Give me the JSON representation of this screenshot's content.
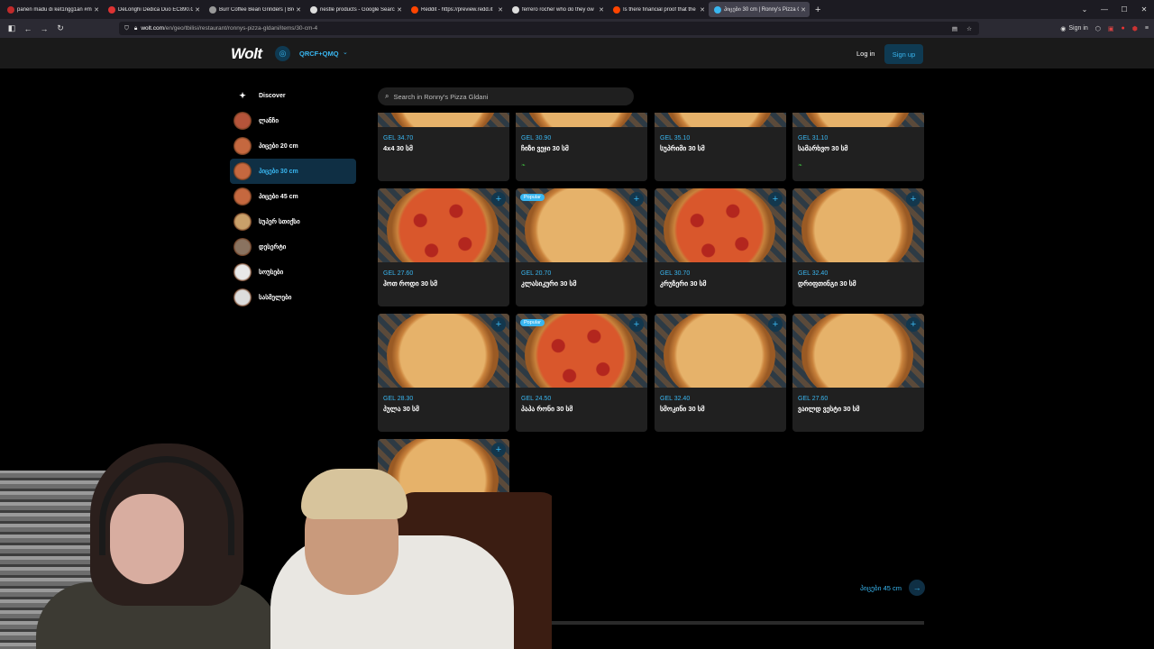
{
  "browser": {
    "tabs": [
      {
        "title": "panen madu di ket1ngg1an #m",
        "fav": "#c02a2a"
      },
      {
        "title": "DeLonghi Dedica Duo EC890.GR",
        "fav": "#d33"
      },
      {
        "title": "Burr Coffee Bean Grinders | Bre",
        "fav": "#999"
      },
      {
        "title": "nestle products - Google Search",
        "fav": "#ddd"
      },
      {
        "title": "Reddit - https://preview.redd.it",
        "fav": "#ff4500"
      },
      {
        "title": "ferrero rocher who do they ow",
        "fav": "#ddd"
      },
      {
        "title": "Is there financial proof that the",
        "fav": "#ff4500"
      },
      {
        "title": "პიცები 30 cm | Ronny's Pizza G",
        "fav": "#39b6f0"
      }
    ],
    "url_domain": "wolt.com",
    "url_path": "/en/geo/tbilisi/restaurant/ronnys-pizza-gldani/items/30-cm-4",
    "sign_in": "Sign in"
  },
  "header": {
    "logo": "Wolt",
    "location": "QRCF+QMQ",
    "login": "Log in",
    "signup": "Sign up"
  },
  "sidebar": {
    "discover": "Discover",
    "items": [
      {
        "label": "ლანჩი",
        "color": "#b5543a"
      },
      {
        "label": "პიცები 20 cm",
        "color": "#c5683f"
      },
      {
        "label": "პიცები 30 cm",
        "color": "#c5683f"
      },
      {
        "label": "პიცები 45 cm",
        "color": "#c5683f"
      },
      {
        "label": "სუპერ სთიქსი",
        "color": "#c9a06a"
      },
      {
        "label": "დესერტი",
        "color": "#8a7360"
      },
      {
        "label": "სოუსები",
        "color": "#e8e8e8"
      },
      {
        "label": "სასმელები",
        "color": "#dcdcdc"
      }
    ]
  },
  "search": {
    "placeholder": "Search in Ronny's Pizza Gldani"
  },
  "items_top": [
    {
      "price": "GEL 34.70",
      "name": "4x4 30 სმ",
      "leaf": false
    },
    {
      "price": "GEL 30.90",
      "name": "ჩიზი ვეჯი 30 სმ",
      "leaf": true
    },
    {
      "price": "GEL 35.10",
      "name": "სუპრიმი 30 სმ",
      "leaf": false
    },
    {
      "price": "GEL 31.10",
      "name": "სამარხვო 30 სმ",
      "leaf": true
    }
  ],
  "items": [
    {
      "price": "GEL 27.60",
      "name": "ჰოთ როდი 30 სმ",
      "badge": "",
      "pep": true
    },
    {
      "price": "GEL 20.70",
      "name": "კლასიკური 30 სმ",
      "badge": "Popular",
      "pep": false
    },
    {
      "price": "GEL 30.70",
      "name": "კრუზერი 30 სმ",
      "badge": "",
      "pep": true
    },
    {
      "price": "GEL 32.40",
      "name": "დრიფთინგი 30 სმ",
      "badge": "",
      "pep": false
    },
    {
      "price": "GEL 28.30",
      "name": "პულა 30 სმ",
      "badge": "",
      "pep": false
    },
    {
      "price": "GEL 24.50",
      "name": "პაპა რონი 30 სმ",
      "badge": "Popular",
      "pep": true
    },
    {
      "price": "GEL 32.40",
      "name": "სმოკინი 30 სმ",
      "badge": "",
      "pep": false
    },
    {
      "price": "GEL 27.60",
      "name": "ვაილდ ვესტი 30 სმ",
      "badge": "",
      "pep": false
    },
    {
      "price": "",
      "name": "",
      "badge": "",
      "pep": false
    }
  ],
  "next_category": "პიცები 45 cm",
  "colors": {
    "accent": "#39b6f0",
    "background": "#000000",
    "card": "#202020"
  }
}
